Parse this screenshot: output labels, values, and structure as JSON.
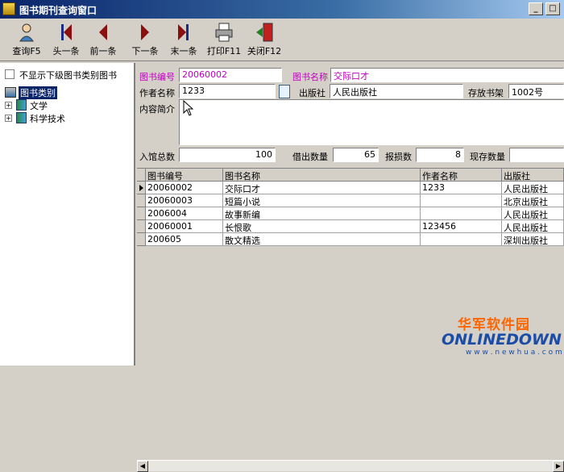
{
  "window": {
    "title": "图书期刊查询窗口",
    "min_symbol": "_",
    "max_symbol": "□"
  },
  "toolbar": {
    "query": "查询F5",
    "first": "头一条",
    "prev": "前一条",
    "next": "下一条",
    "last": "末一条",
    "print": "打印F11",
    "close": "关闭F12"
  },
  "left": {
    "checkbox_label": "不显示下级图书类别图书",
    "tree": {
      "root": "图书类别",
      "children": [
        "文学",
        "科学技术"
      ]
    }
  },
  "form": {
    "book_no_label": "图书编号",
    "book_no": "20060002",
    "book_name_label": "图书名称",
    "book_name": "交际口才",
    "author_label": "作者名称",
    "author": "1233",
    "publisher_label": "出版社",
    "publisher": "人民出版社",
    "shelf_label": "存放书架",
    "shelf": "1002号",
    "summary_label": "内容简介",
    "total_label": "入馆总数",
    "total": "100",
    "borrowed_label": "借出数量",
    "borrowed": "65",
    "damaged_label": "报损数",
    "damaged": "8",
    "stock_label": "现存数量",
    "stock": ""
  },
  "grid": {
    "columns": [
      "图书编号",
      "图书名称",
      "作者名称",
      "出版社"
    ],
    "rows": [
      [
        "20060002",
        "交际口才",
        "1233",
        "人民出版社"
      ],
      [
        "20060003",
        "短篇小说",
        "",
        "北京出版社"
      ],
      [
        "2006004",
        "故事新编",
        "",
        "人民出版社"
      ],
      [
        "20060001",
        "长恨歌",
        "123456",
        "人民出版社"
      ],
      [
        "200605",
        "散文精选",
        "",
        "深圳出版社"
      ]
    ],
    "current_row": 0
  },
  "watermark": {
    "brand_cn": "华军软件园",
    "brand": "ONLINEDOWN",
    "url": "w w w . n e w h u a . c o m"
  },
  "colors": {
    "titlebar": "#0a246a",
    "label_pink": "#c000c0",
    "selected": "#0a246a"
  }
}
